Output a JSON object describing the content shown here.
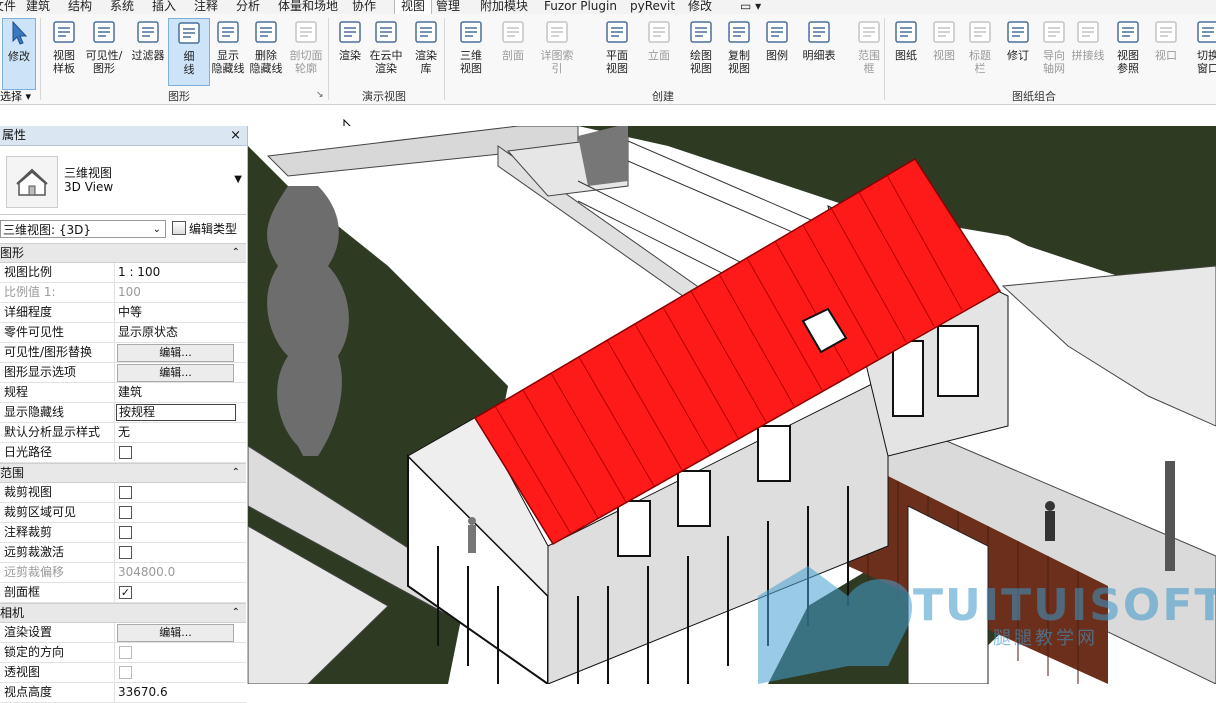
{
  "menu": {
    "tabs": [
      "文件",
      "建筑",
      "结构",
      "系统",
      "插入",
      "注释",
      "分析",
      "体量和场地",
      "协作",
      "视图",
      "管理",
      "附加模块",
      "Fuzor Plugin",
      "pyRevit",
      "修改"
    ],
    "active_index": 9
  },
  "ribbon": {
    "modify": {
      "label": "修改"
    },
    "select": {
      "label": "选择"
    },
    "graphics_buttons": [
      {
        "label1": "视图",
        "label2": "样板"
      },
      {
        "label1": "可见性/",
        "label2": "图形"
      },
      {
        "label1": "过滤器",
        "label2": ""
      },
      {
        "label1": "细",
        "label2": "线"
      },
      {
        "label1": "显示",
        "label2": "隐藏线"
      },
      {
        "label1": "删除",
        "label2": "隐藏线"
      },
      {
        "label1": "剖切面",
        "label2": "轮廓"
      }
    ],
    "graphics_group": "图形",
    "presentation_buttons": [
      {
        "label1": "渲染",
        "label2": ""
      },
      {
        "label1": "在云中",
        "label2": "渲染"
      },
      {
        "label1": "渲染",
        "label2": "库"
      }
    ],
    "presentation_group": "演示视图",
    "create_buttons": [
      {
        "label1": "三维",
        "label2": "视图"
      },
      {
        "label1": "剖面",
        "label2": ""
      },
      {
        "label1": "详图索引",
        "label2": ""
      },
      {
        "label1": "平面",
        "label2": "视图"
      },
      {
        "label1": "立面",
        "label2": ""
      },
      {
        "label1": "绘图",
        "label2": "视图"
      },
      {
        "label1": "复制",
        "label2": "视图"
      },
      {
        "label1": "图例",
        "label2": ""
      },
      {
        "label1": "明细表",
        "label2": ""
      },
      {
        "label1": "范围",
        "label2": "框"
      }
    ],
    "create_group": "创建",
    "sheet_buttons": [
      {
        "label1": "图纸",
        "label2": ""
      },
      {
        "label1": "视图",
        "label2": ""
      },
      {
        "label1": "标题",
        "label2": "栏"
      },
      {
        "label1": "修订",
        "label2": ""
      },
      {
        "label1": "导向",
        "label2": "轴网"
      },
      {
        "label1": "拼接线",
        "label2": ""
      },
      {
        "label1": "视图",
        "label2": "参照"
      },
      {
        "label1": "视口",
        "label2": ""
      },
      {
        "label1": "切换",
        "label2": "窗口"
      }
    ],
    "sheet_group": "图纸组合"
  },
  "properties": {
    "title": "属性",
    "close": "×",
    "type_name_cn": "三维视图",
    "type_name_en": "3D View",
    "view_selector": "三维视图: {3D}",
    "edit_type": "编辑类型",
    "sections": [
      {
        "name": "图形",
        "rows": [
          {
            "k": "视图比例",
            "v": "1 : 100",
            "kind": "text"
          },
          {
            "k": "比例值 1:",
            "v": "100",
            "kind": "grey"
          },
          {
            "k": "详细程度",
            "v": "中等",
            "kind": "text"
          },
          {
            "k": "零件可见性",
            "v": "显示原状态",
            "kind": "text"
          },
          {
            "k": "可见性/图形替换",
            "v": "编辑...",
            "kind": "button"
          },
          {
            "k": "图形显示选项",
            "v": "编辑...",
            "kind": "button"
          },
          {
            "k": "规程",
            "v": "建筑",
            "kind": "text"
          },
          {
            "k": "显示隐藏线",
            "v": "按规程",
            "kind": "input"
          },
          {
            "k": "默认分析显示样式",
            "v": "无",
            "kind": "text"
          },
          {
            "k": "日光路径",
            "v": "",
            "kind": "check"
          }
        ]
      },
      {
        "name": "范围",
        "rows": [
          {
            "k": "裁剪视图",
            "v": "",
            "kind": "check"
          },
          {
            "k": "裁剪区域可见",
            "v": "",
            "kind": "check"
          },
          {
            "k": "注释裁剪",
            "v": "",
            "kind": "check"
          },
          {
            "k": "远剪裁激活",
            "v": "",
            "kind": "check"
          },
          {
            "k": "远剪裁偏移",
            "v": "304800.0",
            "kind": "grey"
          },
          {
            "k": "剖面框",
            "v": "✓",
            "kind": "check"
          }
        ]
      },
      {
        "name": "相机",
        "rows": [
          {
            "k": "渲染设置",
            "v": "编辑...",
            "kind": "button"
          },
          {
            "k": "锁定的方向",
            "v": "",
            "kind": "checkgrey"
          },
          {
            "k": "透视图",
            "v": "",
            "kind": "checkgrey"
          },
          {
            "k": "视点高度",
            "v": "33670.6",
            "kind": "text"
          }
        ]
      }
    ]
  },
  "watermark": {
    "text": "TUITUISOFT",
    "sub": "腿腿教学网"
  },
  "colors": {
    "roof": "#ff1a1a",
    "ground": "#2f3a22",
    "selected": "#cde3f7"
  }
}
